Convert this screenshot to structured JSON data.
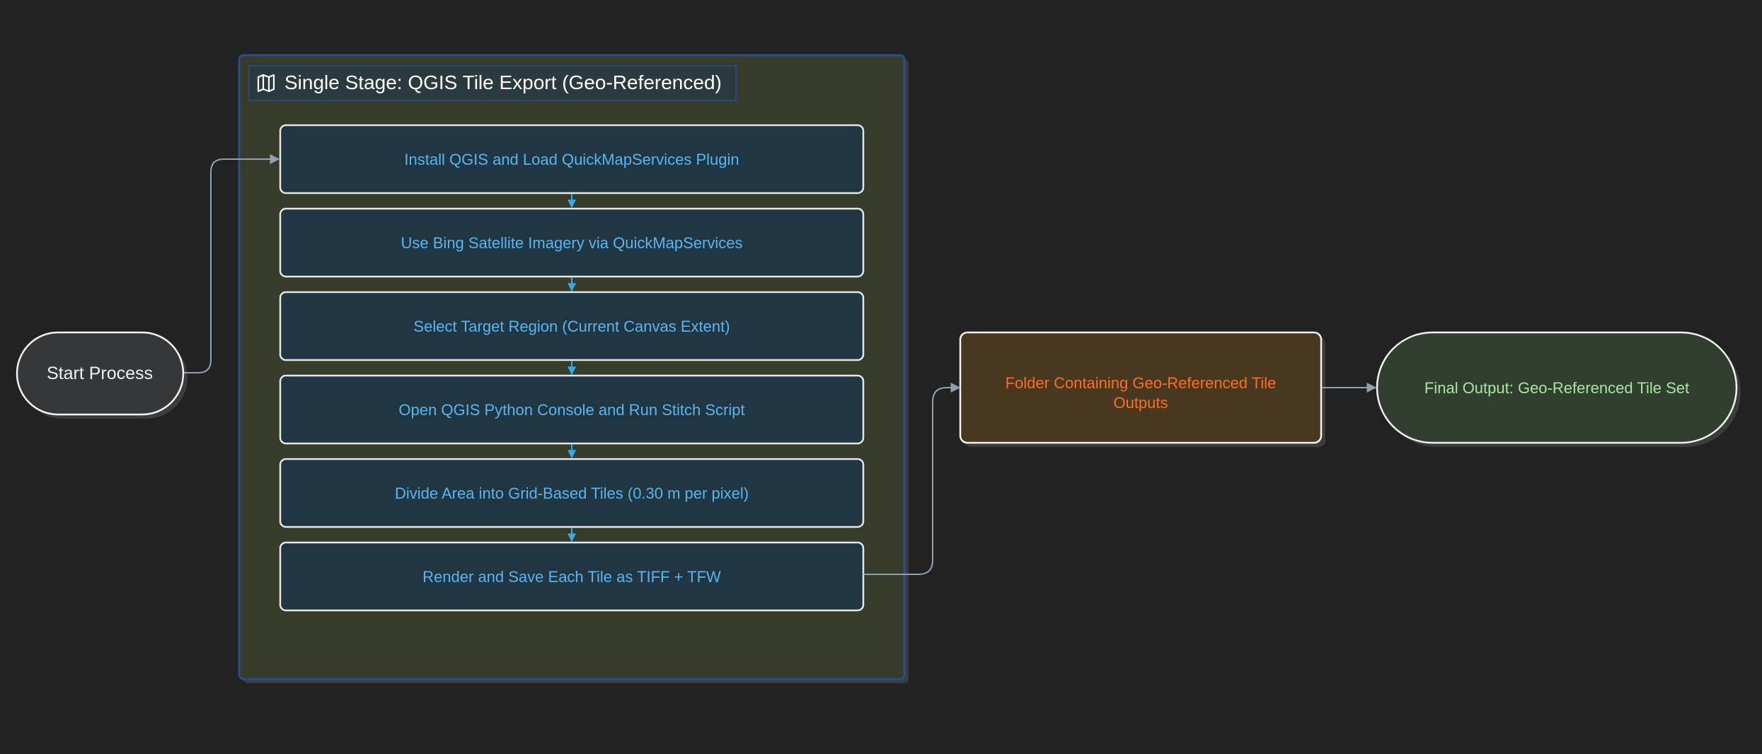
{
  "colors": {
    "background": "#222222",
    "stage_fill": "#373b2a",
    "stage_border": "#25508a",
    "stage_title_fill": "#2a3a3e",
    "stage_title_text": "#ffffff",
    "step_fill": "#213643",
    "step_border": "#e6e6e6",
    "step_text": "#5ab4ee",
    "step_arrow": "#36a8e8",
    "connector": "#8fa2b2",
    "start_fill": "#35383b",
    "start_text": "#f0f0f0",
    "folder_fill": "#47381f",
    "folder_text": "#fb6f22",
    "final_fill": "#323e2f",
    "final_text": "#a6e6a0",
    "node_border": "#f2f2f2",
    "shadow": "#3c3c3c"
  },
  "icons": {
    "stage_icon": "map-icon"
  },
  "start": {
    "label": "Start Process"
  },
  "stage": {
    "title": "Single Stage: QGIS Tile Export (Geo-Referenced)",
    "steps": [
      {
        "label": "Install QGIS and Load QuickMapServices Plugin"
      },
      {
        "label": "Use Bing Satellite Imagery via QuickMapServices"
      },
      {
        "label": "Select Target Region (Current Canvas Extent)"
      },
      {
        "label": "Open QGIS Python Console and Run Stitch Script"
      },
      {
        "label": "Divide Area into Grid-Based Tiles (0.30 m per pixel)"
      },
      {
        "label": "Render and Save Each Tile as TIFF + TFW"
      }
    ]
  },
  "folder": {
    "label_line1": "Folder Containing Geo-Referenced Tile",
    "label_line2": "Outputs"
  },
  "final": {
    "label": "Final Output: Geo-Referenced Tile Set"
  }
}
